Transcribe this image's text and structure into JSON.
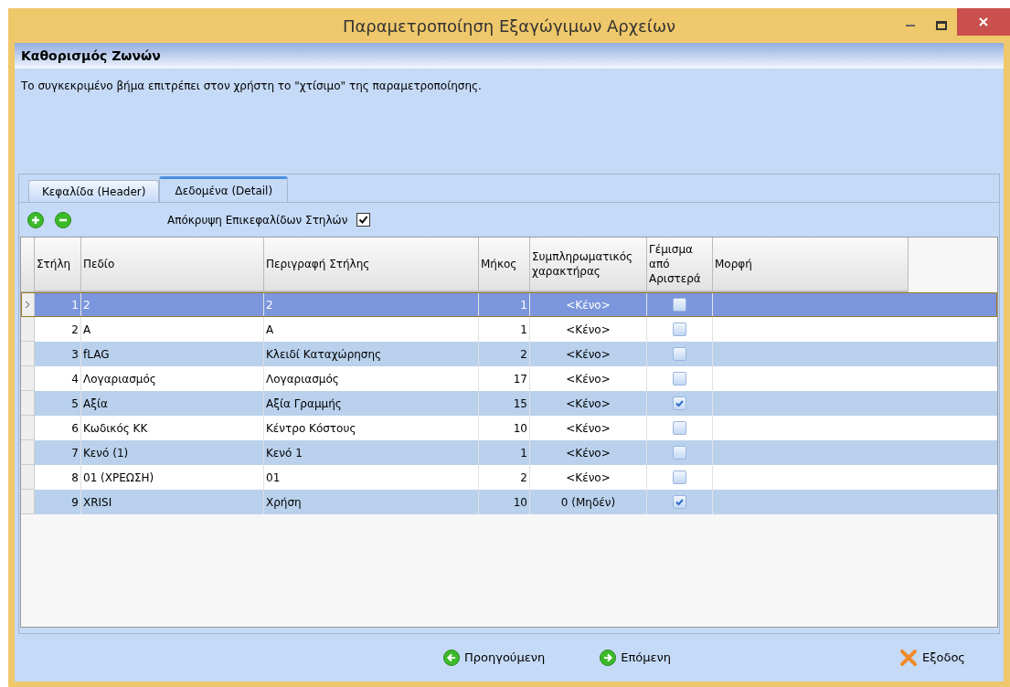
{
  "window": {
    "title": "Παραμετροποίηση Εξαγώγιμων Αρχείων"
  },
  "step": {
    "title": "Καθορισμός Ζωνών",
    "description": "Το συγκεκριμένο βήμα επιτρέπει στον χρήστη το \"χτίσιμο\" της παραμετροποίησης."
  },
  "tabs": [
    {
      "label": "Κεφαλίδα (Header)",
      "selected": false
    },
    {
      "label": "Δεδομένα (Detail)",
      "selected": true
    }
  ],
  "toolbar": {
    "hide_headers": {
      "label": "Απόκρυψη Επικεφαλίδων Στηλών",
      "checked": true
    }
  },
  "table": {
    "columns": [
      "Στήλη",
      "Πεδίο",
      "Περιγραφή Στήλης",
      "Μήκος",
      "Συμπληρωματικός χαρακτήρας",
      "Γέμισμα από Αριστερά",
      "Μορφή"
    ],
    "rows": [
      {
        "column": "1",
        "field": "2",
        "description": "2",
        "length": "1",
        "filler": "<Κένο>",
        "fill_left": false,
        "selected": true
      },
      {
        "column": "2",
        "field": "A",
        "description": "A",
        "length": "1",
        "filler": "<Κένο>",
        "fill_left": false,
        "selected": false
      },
      {
        "column": "3",
        "field": "fLAG",
        "description": "Κλειδί Καταχώρησης",
        "length": "2",
        "filler": "<Κένο>",
        "fill_left": false,
        "selected": false
      },
      {
        "column": "4",
        "field": "Λογαριασμός",
        "description": "Λογαριασμός",
        "length": "17",
        "filler": "<Κένο>",
        "fill_left": false,
        "selected": false
      },
      {
        "column": "5",
        "field": "Αξία",
        "description": "Αξία Γραμμής",
        "length": "15",
        "filler": "<Κένο>",
        "fill_left": true,
        "selected": false
      },
      {
        "column": "6",
        "field": "Κωδικός ΚΚ",
        "description": "Κέντρο Κόστους",
        "length": "10",
        "filler": "<Κένο>",
        "fill_left": false,
        "selected": false
      },
      {
        "column": "7",
        "field": "Κενό (1)",
        "description": "Κενό 1",
        "length": "1",
        "filler": "<Κένο>",
        "fill_left": false,
        "selected": false
      },
      {
        "column": "8",
        "field": "01 (ΧΡΕΩΣΗ)",
        "description": "01",
        "length": "2",
        "filler": "<Κένο>",
        "fill_left": false,
        "selected": false
      },
      {
        "column": "9",
        "field": "XRISI",
        "description": "Χρήση",
        "length": "10",
        "filler": "0 (Μηδέν)",
        "fill_left": true,
        "selected": false
      }
    ]
  },
  "footer": {
    "previous": "Προηγούμενη",
    "next": "Επόμενη",
    "exit": "Εξοδος"
  }
}
